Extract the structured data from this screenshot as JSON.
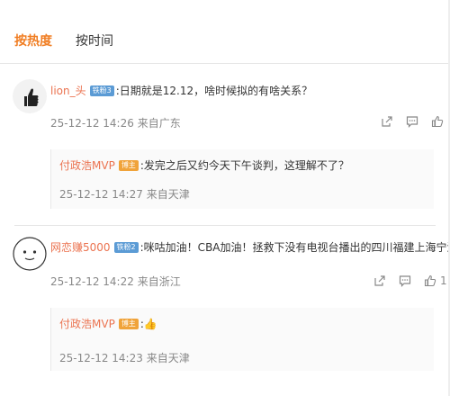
{
  "tabs": {
    "hot": "按热度",
    "time": "按时间"
  },
  "comments": [
    {
      "user": "lion_头",
      "badge": "铁粉3",
      "text": ":日期就是12.12，啥时候拟的有啥关系？",
      "time": "25-12-12 14:26",
      "source": "来自广东",
      "reply": {
        "user": "付政浩MVP",
        "badge": "博主",
        "text": ":发完之后又约今天下午谈判，这理解不了？",
        "time": "25-12-12 14:27",
        "source": "来自天津"
      }
    },
    {
      "user": "网恋赚5000",
      "badge": "铁粉2",
      "text": ":咪咕加油！CBA加油！拯救下没有电视台播出的四川福建上海宁波！",
      "time": "25-12-12 14:22",
      "source": "来自浙江",
      "likes": "1",
      "reply": {
        "user": "付政浩MVP",
        "badge": "博主",
        "text": ":👍",
        "time": "25-12-12 14:23",
        "source": "来自天津"
      }
    }
  ],
  "icons": {
    "share": "share-icon",
    "comment": "comment-icon",
    "like": "like-icon"
  },
  "colors": {
    "accent": "#f07d22",
    "username": "#eb7350",
    "fan_badge": "#5b9bd5",
    "blogger_badge": "#f0a33a",
    "meta": "#888888"
  }
}
